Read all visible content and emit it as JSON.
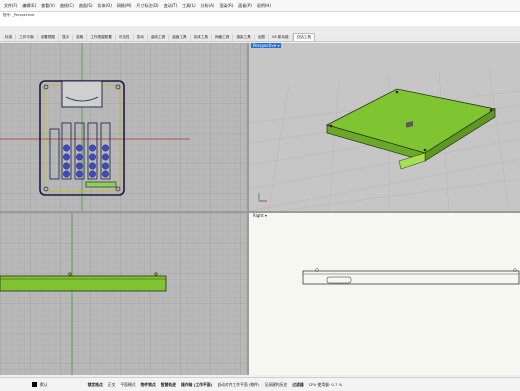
{
  "menu": {
    "items": [
      "文件(F)",
      "编辑(E)",
      "查看(V)",
      "曲线(C)",
      "曲面(S)",
      "实体(O)",
      "网格(M)",
      "尺寸标注(D)",
      "变动(T)",
      "工具(L)",
      "分析(A)",
      "渲染(R)",
      "面板(P)",
      "说明(H)"
    ]
  },
  "command": {
    "history": "指令: _Perspective"
  },
  "tabs": {
    "items": [
      "标准",
      "工作平面",
      "设置视图",
      "显示",
      "选取",
      "工作视窗配置",
      "可见性",
      "变动",
      "曲线工具",
      "曲面工具",
      "实体工具",
      "网格工具",
      "渲染工具",
      "出图",
      "V8 新功能",
      "白话工具"
    ],
    "active_index": 15
  },
  "viewports": {
    "perspective": {
      "label": "Perspective",
      "dropdown_icon": "chevron-down-icon"
    },
    "right": {
      "label": "Right",
      "dropdown_icon": "chevron-down-icon"
    }
  },
  "statusbar": {
    "layer_label": "默认",
    "items": [
      "锁定格点",
      "正交",
      "平面模式",
      "物件锁点",
      "智慧轨迹",
      "操作轴 (工作平面)",
      "自动对齐工作平面 (物件)",
      "记录建构历史",
      "过滤器",
      "CPU 使用量: 0.7 %"
    ]
  },
  "colors": {
    "model_green": "#7fc532",
    "model_edge": "#2e2e6a",
    "accent_blue": "#2e6fd8",
    "grid_bg": "#b9b9b9"
  }
}
